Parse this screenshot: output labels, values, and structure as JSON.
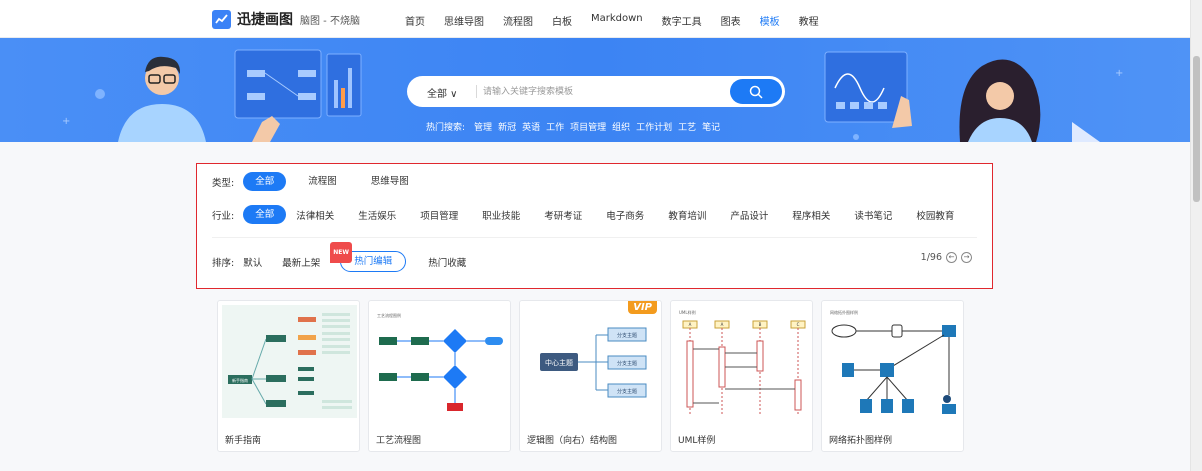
{
  "brand": {
    "name": "迅捷画图",
    "slogan": "脑图 - 不烧脑"
  },
  "nav": {
    "items": [
      "首页",
      "思维导图",
      "流程图",
      "白板",
      "Markdown",
      "数字工具",
      "图表",
      "模板",
      "教程"
    ],
    "active_index": 7
  },
  "search": {
    "scope": "全部 ∨",
    "placeholder": "请输入关键字搜索模板",
    "hot_label": "热门搜索:",
    "hot_terms": [
      "管理",
      "新冠",
      "英语",
      "工作",
      "项目管理",
      "组织",
      "工作计划",
      "工艺",
      "笔记"
    ]
  },
  "filters": {
    "type_label": "类型:",
    "types": [
      "全部",
      "流程图",
      "思维导图"
    ],
    "industry_label": "行业:",
    "industries": [
      "全部",
      "法律相关",
      "生活娱乐",
      "项目管理",
      "职业技能",
      "考研考证",
      "电子商务",
      "教育培训",
      "产品设计",
      "程序相关",
      "读书笔记",
      "校园教育"
    ],
    "sort_label": "排序:",
    "sorts": [
      "默认",
      "最新上架",
      "热门编辑",
      "热门收藏"
    ],
    "new_badge": "NEW",
    "pager": "1/96"
  },
  "cards": [
    {
      "title": "新手指南",
      "thumb": {
        "center": "新手指南"
      }
    },
    {
      "title": "工艺流程图",
      "thumb": {
        "caption": "工艺流程图例"
      }
    },
    {
      "title": "逻辑图（向右）结构图",
      "vip": "VIP",
      "thumb": {
        "center": "中心主题",
        "branches": [
          "分支主题",
          "分支主题",
          "分支主题"
        ]
      }
    },
    {
      "title": "UML样例",
      "thumb": {
        "caption": "UML样例",
        "heads": [
          "A",
          "A",
          "B",
          "C"
        ]
      }
    },
    {
      "title": "网络拓扑图样例",
      "thumb": {
        "caption": "网络拓扑图样例"
      }
    }
  ],
  "colors": {
    "accent": "#1d7af5",
    "banner": "#3c84f3",
    "highlight_border": "#e0282e",
    "vip": "#f39b1e"
  }
}
